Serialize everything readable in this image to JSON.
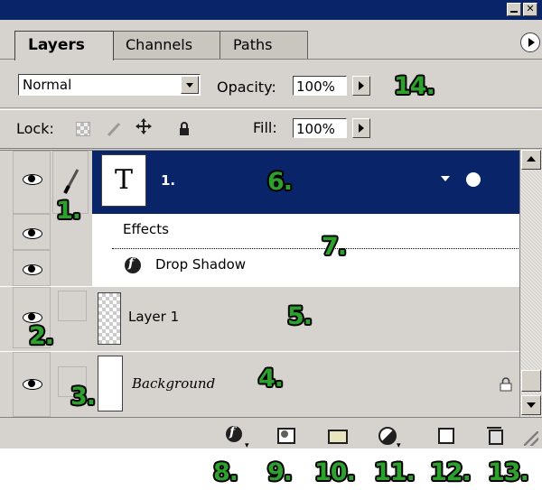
{
  "window": {
    "minimize_glyph": "",
    "close_glyph": "✕"
  },
  "tabs": [
    {
      "label": "Layers",
      "active": true
    },
    {
      "label": "Channels",
      "active": false
    },
    {
      "label": "Paths",
      "active": false
    }
  ],
  "blend": {
    "mode": "Normal",
    "opacity_label": "Opacity:",
    "opacity_value": "100%"
  },
  "lock": {
    "label": "Lock:",
    "fill_label": "Fill:",
    "fill_value": "100%"
  },
  "layers": [
    {
      "name": "1.",
      "thumb": "T",
      "selected": true,
      "type": "text"
    },
    {
      "name": "Layer 1",
      "selected": false,
      "type": "pixel"
    },
    {
      "name": "Background",
      "selected": false,
      "type": "background",
      "locked": true
    }
  ],
  "effects": {
    "header": "Effects",
    "items": [
      "Drop Shadow"
    ]
  },
  "annotations": [
    "1.",
    "2.",
    "3.",
    "4.",
    "5.",
    "6.",
    "7.",
    "8.",
    "9.",
    "10.",
    "11.",
    "12.",
    "13.",
    "14."
  ],
  "colors": {
    "panel_bg": "#d6d3ce",
    "selection": "#0a246a",
    "annotation": "#2ea02e"
  }
}
